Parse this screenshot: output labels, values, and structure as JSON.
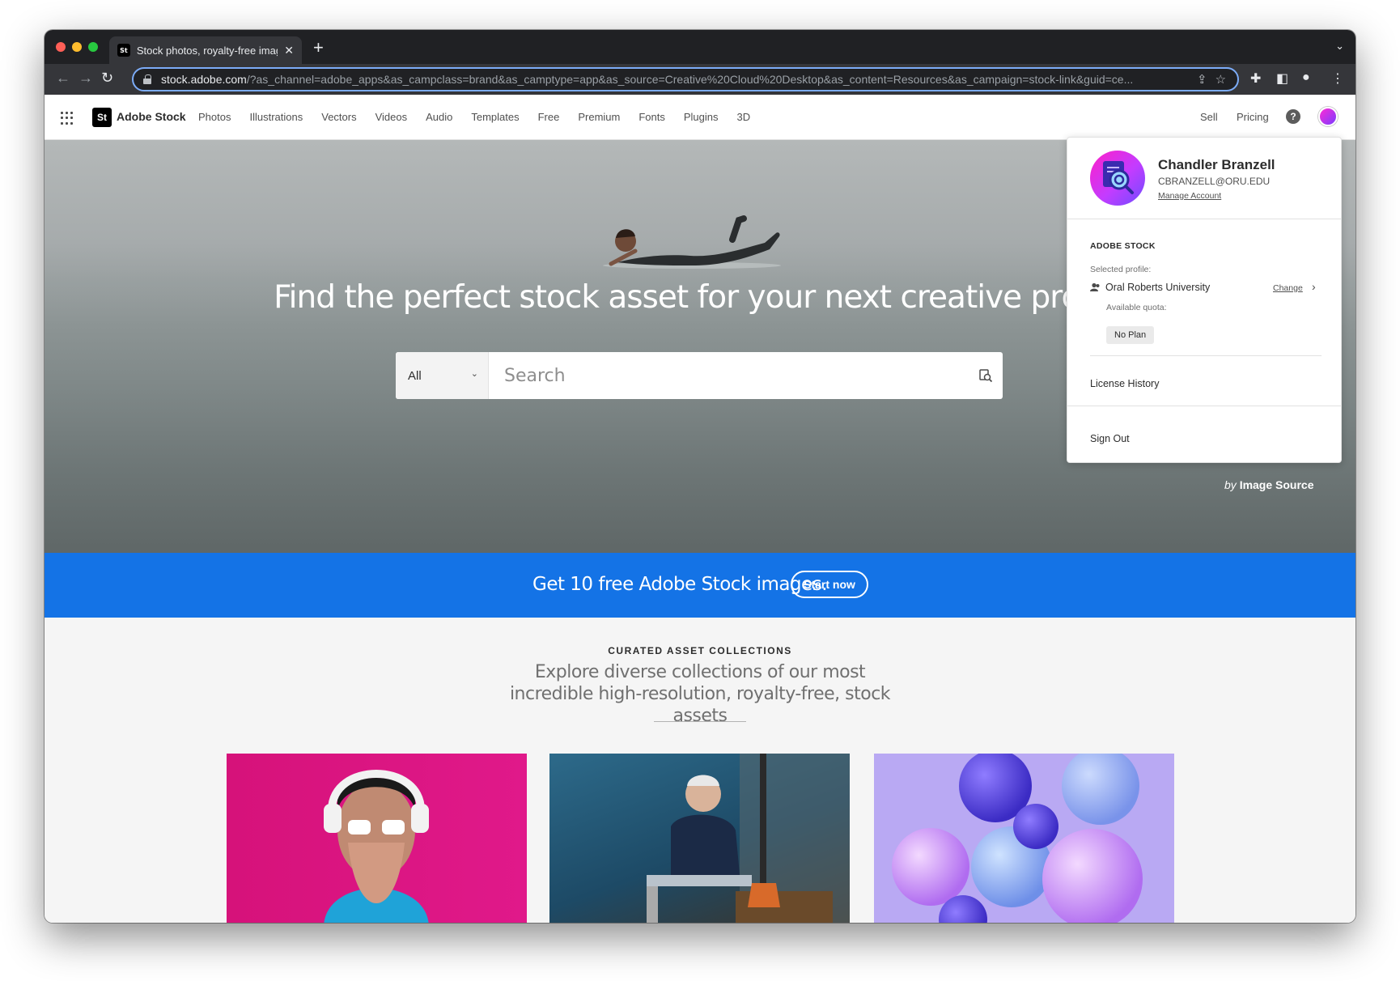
{
  "browser": {
    "tab_title": "Stock photos, royalty-free imag",
    "tab_favicon": "St",
    "url_host": "stock.adobe.com",
    "url_path": "/?as_channel=adobe_apps&as_campclass=brand&as_camptype=app&as_source=Creative%20Cloud%20Desktop&as_content=Resources&as_campaign=stock-link&guid=ce..."
  },
  "header": {
    "logo": "St",
    "brand": "Adobe Stock",
    "nav": [
      "Photos",
      "Illustrations",
      "Vectors",
      "Videos",
      "Audio",
      "Templates",
      "Free",
      "Premium",
      "Fonts",
      "Plugins",
      "3D"
    ],
    "sell": "Sell",
    "pricing": "Pricing"
  },
  "hero": {
    "title": "Find the perfect stock asset for your next creative project",
    "search_category": "All",
    "search_placeholder": "Search",
    "credit_by": "by",
    "credit_name": "Image Source"
  },
  "promo": {
    "text": "Get 10 free Adobe Stock images.",
    "button": "Start now"
  },
  "collections": {
    "eyebrow": "CURATED ASSET COLLECTIONS",
    "subtitle": "Explore diverse collections of our most incredible high-resolution, royalty-free, stock assets"
  },
  "account": {
    "name": "Chandler Branzell",
    "email": "CBRANZELL@ORU.EDU",
    "manage": "Manage Account",
    "section": "ADOBE STOCK",
    "selected_profile_label": "Selected profile:",
    "profile_name": "Oral Roberts University",
    "change": "Change",
    "quota_label": "Available quota:",
    "plan": "No Plan",
    "license_history": "License History",
    "sign_out": "Sign Out"
  },
  "colors": {
    "promo_blue": "#1473e6",
    "omnibox_focus": "#7cacf8",
    "avatar_pink": "#ff1fc8"
  }
}
